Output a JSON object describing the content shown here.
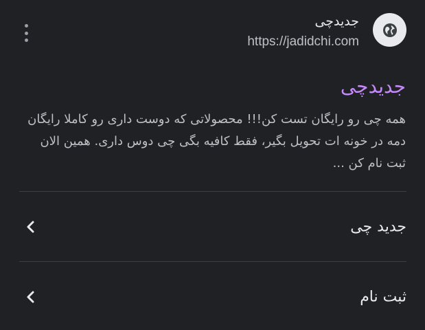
{
  "header": {
    "site_name": "جدیدچی",
    "site_url": "https://jadidchi.com",
    "favicon": "globe-icon",
    "menu_icon": "more-vert-icon"
  },
  "result": {
    "title": "جدیدچی",
    "snippet": "همه چی رو رایگان تست کن!!! محصولاتی که دوست داری رو کاملا رایگان دمه در خونه ات تحویل بگیر، فقط کافیه بگی چی دوس داری. همین الان ثبت نام کن ..."
  },
  "sitelinks": [
    {
      "label": "جدید چی",
      "icon": "chevron-left-icon"
    },
    {
      "label": "ثبت نام",
      "icon": "chevron-left-icon"
    }
  ],
  "colors": {
    "background": "#202124",
    "title": "#c58af9",
    "text": "#bdc1c6",
    "text_strong": "#e8eaed",
    "divider": "#3c4043"
  }
}
